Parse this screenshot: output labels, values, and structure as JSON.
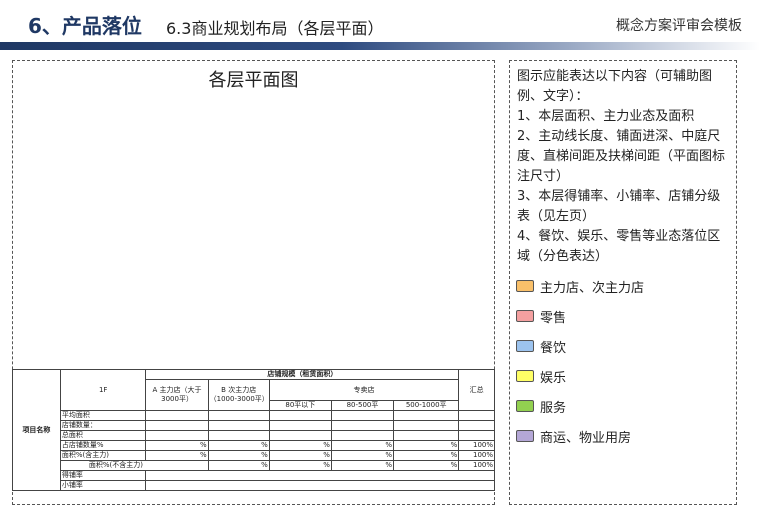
{
  "header": {
    "section": "6、产品落位",
    "subtitle": "6.3商业规划布局（各层平面）",
    "template": "概念方案评审会模板"
  },
  "plan": {
    "title": "各层平面图"
  },
  "notes": {
    "lines": [
      "图示应能表达以下内容（可辅助图例、文字）：",
      "1、本层面积、主力业态及面积",
      "2、主动线长度、铺面进深、中庭尺度、直梯间距及扶梯间距（平面图标注尺寸）",
      "3、本层得铺率、小铺率、店铺分级表（见左页）",
      "4、餐饮、娱乐、零售等业态落位区域（分色表达）"
    ]
  },
  "legend": [
    {
      "label": "主力店、次主力店",
      "color": "#f9c06a"
    },
    {
      "label": "零售",
      "color": "#f4a0a0"
    },
    {
      "label": "餐饮",
      "color": "#9cc3ee"
    },
    {
      "label": "娱乐",
      "color": "#ffff66"
    },
    {
      "label": "服务",
      "color": "#92d050"
    },
    {
      "label": "商运、物业用房",
      "color": "#b4a7d6"
    }
  ],
  "table": {
    "project_label": "项目名称",
    "floor": "1F",
    "scale_header": "店铺规模（租赁面积）",
    "col_a": "A 主力店（大于3000平）",
    "col_b": "B 次主力店（1000-3000平）",
    "col_special": "专卖店",
    "sub1": "80平以下",
    "sub2": "80-500平",
    "sub3": "500-1000平",
    "total": "汇总",
    "rows": {
      "avg_area": "平均面积",
      "shop_count": "店铺数量：",
      "total_area": "总面积",
      "shop_pct": "占店铺数量%",
      "area_pct_incl": "面积%(含主力)",
      "area_pct_excl": "面积%(不含主力)",
      "shop_rate": "得铺率",
      "small_rate": "小铺率"
    },
    "pct": "%",
    "hundred": "100%"
  }
}
